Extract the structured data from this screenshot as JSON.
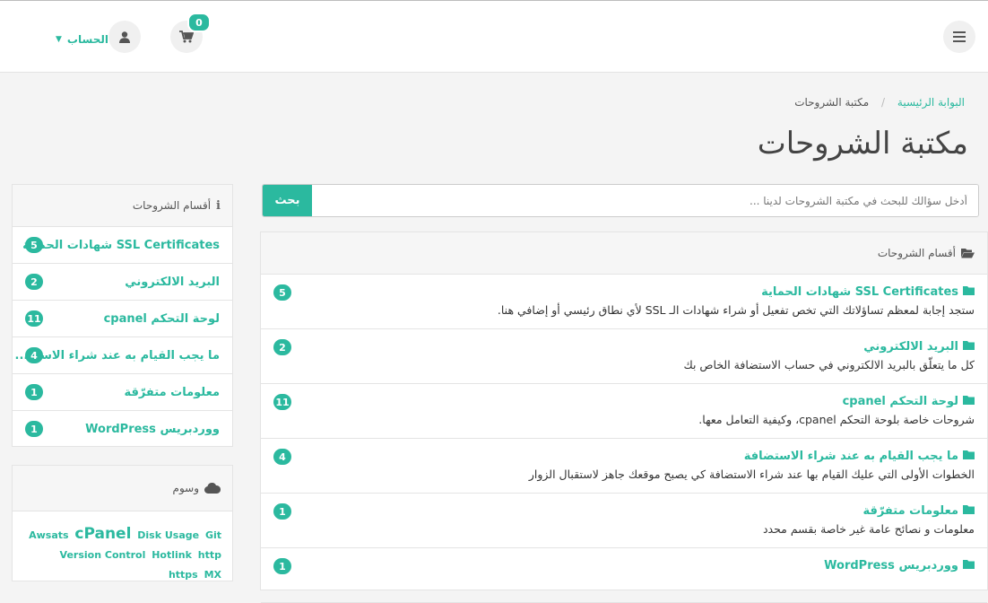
{
  "header": {
    "cart_count": "0",
    "account_label": "الحساب"
  },
  "breadcrumb": {
    "home": "البوابة الرئيسية",
    "separator": "/",
    "current": "مكتبة الشروحات"
  },
  "page_title": "مكتبة الشروحات",
  "search": {
    "placeholder": "أدخل سؤالك للبحث في مكتبة الشروحات لدينا ...",
    "button": "بحث"
  },
  "categories_panel": {
    "title": "أقسام الشروحات",
    "items": [
      {
        "title": "SSL Certificates شهادات الحماية",
        "desc": "ستجد إجابة لمعظم تساؤلاتك التي تخص تفعيل أو شراء شهادات الـ SSL لأي نطاق رئيسي أو إضافي هنا.",
        "count": "5"
      },
      {
        "title": "البريد الالكتروني",
        "desc": "كل ما يتعلّق بالبريد الالكتروني في حساب الاستضافة الخاص بك",
        "count": "2"
      },
      {
        "title": "لوحة التحكم cpanel",
        "desc": "شروحات خاصة بلوحة التحكم cpanel، وكيفية التعامل معها.",
        "count": "11"
      },
      {
        "title": "ما يجب القيام به عند شراء الاستضافة",
        "desc": "الخطوات الأولى التي عليك القيام بها عند شراء الاستضافة كي يصبح موقعك جاهز لاستقبال الزوار",
        "count": "4"
      },
      {
        "title": "معلومات متفرّقة",
        "desc": "معلومات و نصائح عامة غير خاصة بقسم محدد",
        "count": "1"
      },
      {
        "title": "ووردبريس WordPress",
        "desc": "",
        "count": "1"
      }
    ]
  },
  "sidebar": {
    "title": "أقسام الشروحات",
    "items": [
      {
        "label": "SSL Certificates شهادات الحماية",
        "count": "5"
      },
      {
        "label": "البريد الالكتروني",
        "count": "2"
      },
      {
        "label": "لوحة التحكم cpanel",
        "count": "11"
      },
      {
        "label": "ما يجب القيام به عند شراء الاست...",
        "count": "4"
      },
      {
        "label": "معلومات متفرّقة",
        "count": "1"
      },
      {
        "label": "ووردبريس WordPress",
        "count": "1"
      }
    ]
  },
  "tags": {
    "title": "وسوم",
    "items": [
      "Awsats",
      "cPanel",
      "Disk Usage",
      "Git",
      "Version Control",
      "Hotlink",
      "http",
      "https",
      "MX"
    ]
  },
  "colors": {
    "accent": "#2bb99f"
  }
}
